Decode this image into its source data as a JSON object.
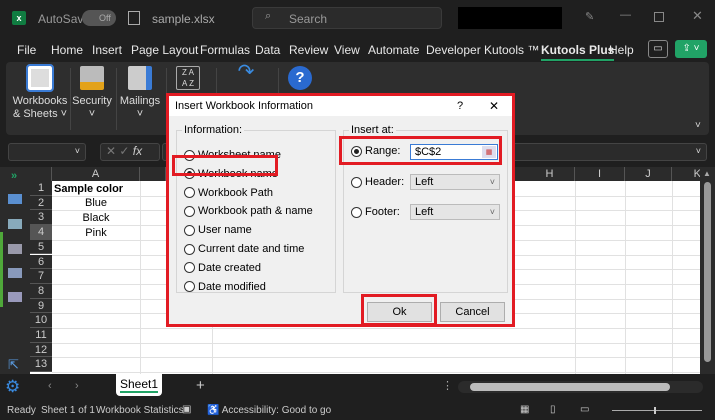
{
  "titlebar": {
    "autosave_label": "AutoSave",
    "autosave_state": "Off",
    "filename": "sample.xlsx",
    "search_placeholder": "Search"
  },
  "menu": [
    "File",
    "Home",
    "Insert",
    "Page Layout",
    "Formulas",
    "Data",
    "Review",
    "View",
    "Automate",
    "Developer",
    "Kutools ™",
    "Kutools Plus",
    "Help"
  ],
  "menu_active": "Kutools Plus",
  "ribbon": {
    "workbooks": "Workbooks",
    "sheets": "& Sheets",
    "security": "Security",
    "mailings": "Mailings"
  },
  "formula_bar": {
    "fx": "fx"
  },
  "columns": [
    "A",
    "",
    "",
    "",
    "",
    "",
    "",
    "H",
    "I",
    "J",
    "K"
  ],
  "rows": [
    "1",
    "2",
    "3",
    "4",
    "5",
    "6",
    "7",
    "8",
    "9",
    "10",
    "11",
    "12",
    "13"
  ],
  "cells": {
    "a1": "Sample color",
    "a2": "Blue",
    "a3": "Black",
    "a4": "Pink"
  },
  "sheet_tab": "Sheet1",
  "status": {
    "ready": "Ready",
    "sheet": "Sheet 1 of 1",
    "stats": "Workbook Statistics",
    "accessibility": "Accessibility: Good to go"
  },
  "dialog": {
    "title": "Insert Workbook Information",
    "help": "?",
    "close": "✕",
    "information_label": "Information:",
    "options": [
      "Worksheet name",
      "Workbook name",
      "Workbook Path",
      "Workbook path & name",
      "User name",
      "Current date and time",
      "Date created",
      "Date modified"
    ],
    "selected_option": "Workbook name",
    "insert_at_label": "Insert at:",
    "range_label": "Range:",
    "range_value": "$C$2",
    "header_label": "Header:",
    "header_value": "Left",
    "footer_label": "Footer:",
    "footer_value": "Left",
    "ok": "Ok",
    "cancel": "Cancel"
  },
  "colors": {
    "highlight": "#e21b23",
    "accent": "#21a366"
  }
}
